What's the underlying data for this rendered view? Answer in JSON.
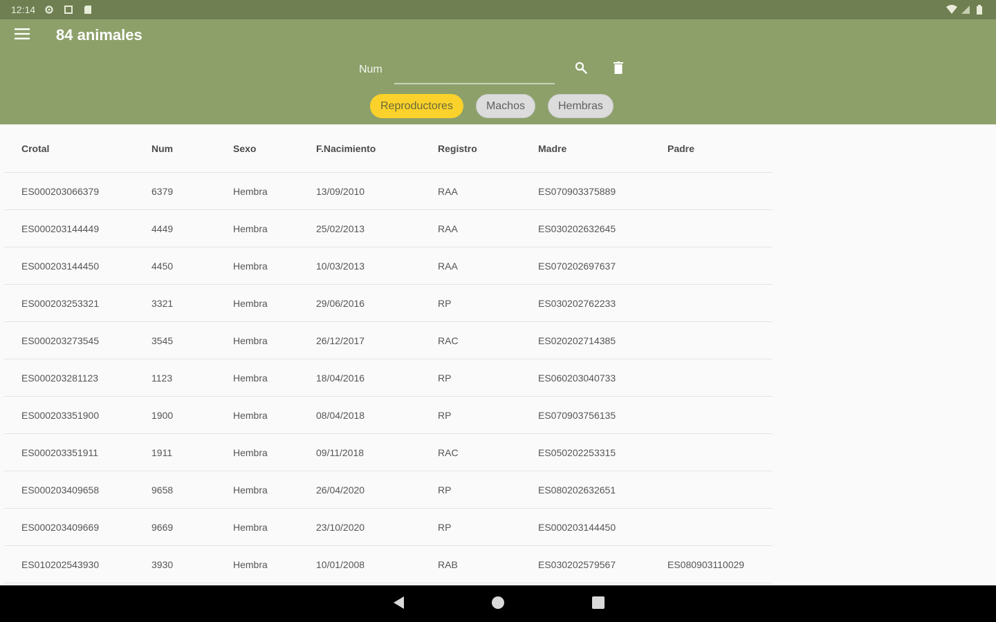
{
  "status_bar": {
    "time": "12:14"
  },
  "app_bar": {
    "title": "84 animales"
  },
  "search": {
    "label": "Num",
    "value": ""
  },
  "chips": [
    {
      "label": "Reproductores",
      "active": true
    },
    {
      "label": "Machos",
      "active": false
    },
    {
      "label": "Hembras",
      "active": false
    }
  ],
  "table": {
    "headers": [
      "Crotal",
      "Num",
      "Sexo",
      "F.Nacimiento",
      "Registro",
      "Madre",
      "Padre"
    ],
    "rows": [
      [
        "ES000203066379",
        "6379",
        "Hembra",
        "13/09/2010",
        "RAA",
        "ES070903375889",
        ""
      ],
      [
        "ES000203144449",
        "4449",
        "Hembra",
        "25/02/2013",
        "RAA",
        "ES030202632645",
        ""
      ],
      [
        "ES000203144450",
        "4450",
        "Hembra",
        "10/03/2013",
        "RAA",
        "ES070202697637",
        ""
      ],
      [
        "ES000203253321",
        "3321",
        "Hembra",
        "29/06/2016",
        "RP",
        "ES030202762233",
        ""
      ],
      [
        "ES000203273545",
        "3545",
        "Hembra",
        "26/12/2017",
        "RAC",
        "ES020202714385",
        ""
      ],
      [
        "ES000203281123",
        "1123",
        "Hembra",
        "18/04/2016",
        "RP",
        "ES060203040733",
        ""
      ],
      [
        "ES000203351900",
        "1900",
        "Hembra",
        "08/04/2018",
        "RP",
        "ES070903756135",
        ""
      ],
      [
        "ES000203351911",
        "1911",
        "Hembra",
        "09/11/2018",
        "RAC",
        "ES050202253315",
        ""
      ],
      [
        "ES000203409658",
        "9658",
        "Hembra",
        "26/04/2020",
        "RP",
        "ES080202632651",
        ""
      ],
      [
        "ES000203409669",
        "9669",
        "Hembra",
        "23/10/2020",
        "RP",
        "ES000203144450",
        ""
      ],
      [
        "ES010202543930",
        "3930",
        "Hembra",
        "10/01/2008",
        "RAB",
        "ES030202579567",
        "ES080903110029"
      ]
    ]
  },
  "colors": {
    "app_bar": "#8da06a",
    "status_bar": "#6f7f52",
    "chip_active": "#fbd22b",
    "chip_inactive": "#dcdcdc"
  },
  "icons": {
    "menu": "menu-icon",
    "search": "search-icon",
    "delete": "trash-icon",
    "back": "back-icon",
    "home": "home-icon",
    "recents": "recents-icon"
  }
}
